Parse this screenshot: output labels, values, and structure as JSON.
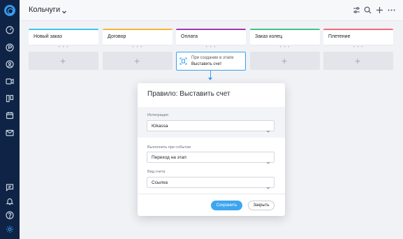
{
  "app": {
    "title": "Кольчуги"
  },
  "columns": [
    {
      "label": "Новый заказ",
      "color": "#3ec4e9"
    },
    {
      "label": "Договор",
      "color": "#f5b73b"
    },
    {
      "label": "Оплата",
      "color": "#9b3bb3"
    },
    {
      "label": "Заказ колец",
      "color": "#3ec48a"
    },
    {
      "label": "Плетение",
      "color": "#f36c7a"
    }
  ],
  "add_symbol": "+",
  "dots": "• • •",
  "rule_card": {
    "line1": "При создании в этапе",
    "line2": "Выставить счет"
  },
  "modal": {
    "title": "Правило: Выставить счет",
    "integration": {
      "label": "Интеграция",
      "value": "Юkassa"
    },
    "event": {
      "label": "Выполнить при событии",
      "value": "Переход на этап"
    },
    "invoice_type": {
      "label": "Вид счета",
      "value": "Ссылка"
    },
    "save_label": "Сохранить",
    "close_label": "Закрыть"
  },
  "colors": {
    "accent": "#3ea6f0",
    "sidebar": "#0e2345"
  }
}
